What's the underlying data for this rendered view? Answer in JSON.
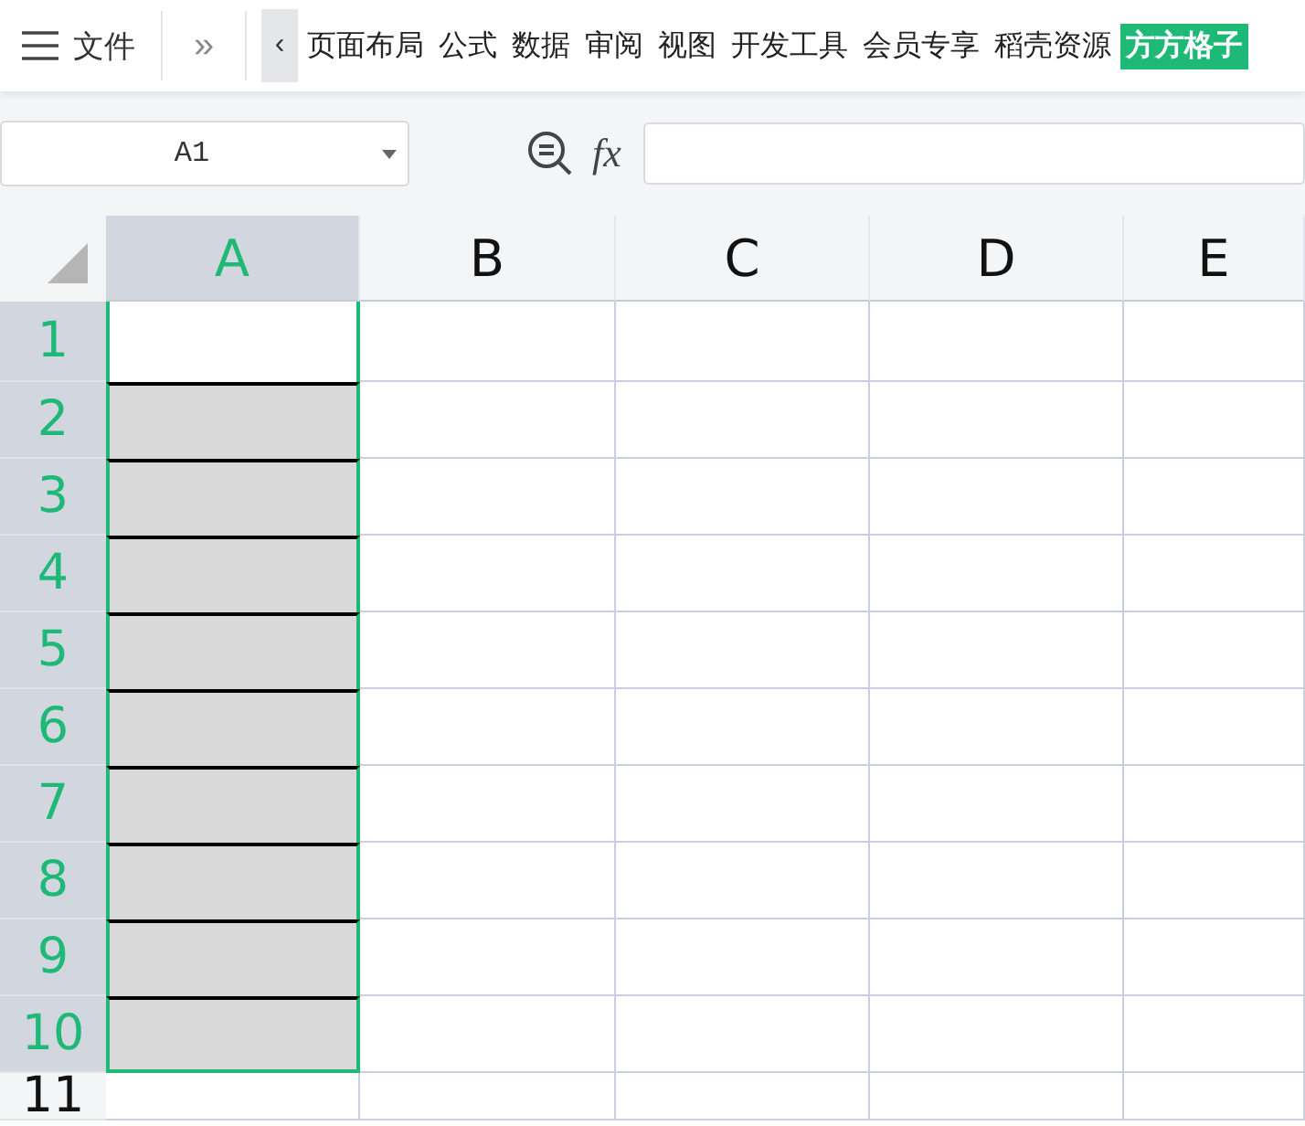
{
  "toolbar": {
    "menu_label": "文件",
    "more_label": "»",
    "scroll_label": "‹",
    "tabs": [
      {
        "label": "页面布局",
        "selected": false
      },
      {
        "label": "公式",
        "selected": false
      },
      {
        "label": "数据",
        "selected": false
      },
      {
        "label": "审阅",
        "selected": false
      },
      {
        "label": "视图",
        "selected": false
      },
      {
        "label": "开发工具",
        "selected": false
      },
      {
        "label": "会员专享",
        "selected": false
      },
      {
        "label": "稻壳资源",
        "selected": false
      },
      {
        "label": "方方格子",
        "selected": true
      }
    ]
  },
  "formula_bar": {
    "name_box": "A1",
    "fx_label": "fx"
  },
  "columns": [
    {
      "label": "A",
      "selected": true
    },
    {
      "label": "B",
      "selected": false
    },
    {
      "label": "C",
      "selected": false
    },
    {
      "label": "D",
      "selected": false
    },
    {
      "label": "E",
      "selected": false
    }
  ],
  "rows": [
    {
      "label": "1",
      "selected": true,
      "filled": false
    },
    {
      "label": "2",
      "selected": true,
      "filled": true
    },
    {
      "label": "3",
      "selected": true,
      "filled": true
    },
    {
      "label": "4",
      "selected": true,
      "filled": true
    },
    {
      "label": "5",
      "selected": true,
      "filled": true
    },
    {
      "label": "6",
      "selected": true,
      "filled": true
    },
    {
      "label": "7",
      "selected": true,
      "filled": true
    },
    {
      "label": "8",
      "selected": true,
      "filled": true
    },
    {
      "label": "9",
      "selected": true,
      "filled": true
    },
    {
      "label": "10",
      "selected": true,
      "filled": true
    },
    {
      "label": "11",
      "selected": false,
      "filled": false
    }
  ]
}
